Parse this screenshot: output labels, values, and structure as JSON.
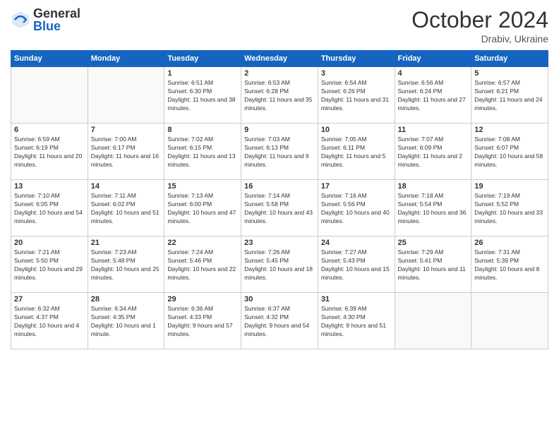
{
  "header": {
    "logo_general": "General",
    "logo_blue": "Blue",
    "month_title": "October 2024",
    "location": "Drabiv, Ukraine"
  },
  "weekdays": [
    "Sunday",
    "Monday",
    "Tuesday",
    "Wednesday",
    "Thursday",
    "Friday",
    "Saturday"
  ],
  "weeks": [
    [
      {
        "day": "",
        "sunrise": "",
        "sunset": "",
        "daylight": ""
      },
      {
        "day": "",
        "sunrise": "",
        "sunset": "",
        "daylight": ""
      },
      {
        "day": "1",
        "sunrise": "Sunrise: 6:51 AM",
        "sunset": "Sunset: 6:30 PM",
        "daylight": "Daylight: 11 hours and 38 minutes."
      },
      {
        "day": "2",
        "sunrise": "Sunrise: 6:53 AM",
        "sunset": "Sunset: 6:28 PM",
        "daylight": "Daylight: 11 hours and 35 minutes."
      },
      {
        "day": "3",
        "sunrise": "Sunrise: 6:54 AM",
        "sunset": "Sunset: 6:26 PM",
        "daylight": "Daylight: 11 hours and 31 minutes."
      },
      {
        "day": "4",
        "sunrise": "Sunrise: 6:56 AM",
        "sunset": "Sunset: 6:24 PM",
        "daylight": "Daylight: 11 hours and 27 minutes."
      },
      {
        "day": "5",
        "sunrise": "Sunrise: 6:57 AM",
        "sunset": "Sunset: 6:21 PM",
        "daylight": "Daylight: 11 hours and 24 minutes."
      }
    ],
    [
      {
        "day": "6",
        "sunrise": "Sunrise: 6:59 AM",
        "sunset": "Sunset: 6:19 PM",
        "daylight": "Daylight: 11 hours and 20 minutes."
      },
      {
        "day": "7",
        "sunrise": "Sunrise: 7:00 AM",
        "sunset": "Sunset: 6:17 PM",
        "daylight": "Daylight: 11 hours and 16 minutes."
      },
      {
        "day": "8",
        "sunrise": "Sunrise: 7:02 AM",
        "sunset": "Sunset: 6:15 PM",
        "daylight": "Daylight: 11 hours and 13 minutes."
      },
      {
        "day": "9",
        "sunrise": "Sunrise: 7:03 AM",
        "sunset": "Sunset: 6:13 PM",
        "daylight": "Daylight: 11 hours and 9 minutes."
      },
      {
        "day": "10",
        "sunrise": "Sunrise: 7:05 AM",
        "sunset": "Sunset: 6:11 PM",
        "daylight": "Daylight: 11 hours and 5 minutes."
      },
      {
        "day": "11",
        "sunrise": "Sunrise: 7:07 AM",
        "sunset": "Sunset: 6:09 PM",
        "daylight": "Daylight: 11 hours and 2 minutes."
      },
      {
        "day": "12",
        "sunrise": "Sunrise: 7:08 AM",
        "sunset": "Sunset: 6:07 PM",
        "daylight": "Daylight: 10 hours and 58 minutes."
      }
    ],
    [
      {
        "day": "13",
        "sunrise": "Sunrise: 7:10 AM",
        "sunset": "Sunset: 6:05 PM",
        "daylight": "Daylight: 10 hours and 54 minutes."
      },
      {
        "day": "14",
        "sunrise": "Sunrise: 7:11 AM",
        "sunset": "Sunset: 6:02 PM",
        "daylight": "Daylight: 10 hours and 51 minutes."
      },
      {
        "day": "15",
        "sunrise": "Sunrise: 7:13 AM",
        "sunset": "Sunset: 6:00 PM",
        "daylight": "Daylight: 10 hours and 47 minutes."
      },
      {
        "day": "16",
        "sunrise": "Sunrise: 7:14 AM",
        "sunset": "Sunset: 5:58 PM",
        "daylight": "Daylight: 10 hours and 43 minutes."
      },
      {
        "day": "17",
        "sunrise": "Sunrise: 7:16 AM",
        "sunset": "Sunset: 5:56 PM",
        "daylight": "Daylight: 10 hours and 40 minutes."
      },
      {
        "day": "18",
        "sunrise": "Sunrise: 7:18 AM",
        "sunset": "Sunset: 5:54 PM",
        "daylight": "Daylight: 10 hours and 36 minutes."
      },
      {
        "day": "19",
        "sunrise": "Sunrise: 7:19 AM",
        "sunset": "Sunset: 5:52 PM",
        "daylight": "Daylight: 10 hours and 33 minutes."
      }
    ],
    [
      {
        "day": "20",
        "sunrise": "Sunrise: 7:21 AM",
        "sunset": "Sunset: 5:50 PM",
        "daylight": "Daylight: 10 hours and 29 minutes."
      },
      {
        "day": "21",
        "sunrise": "Sunrise: 7:23 AM",
        "sunset": "Sunset: 5:48 PM",
        "daylight": "Daylight: 10 hours and 25 minutes."
      },
      {
        "day": "22",
        "sunrise": "Sunrise: 7:24 AM",
        "sunset": "Sunset: 5:46 PM",
        "daylight": "Daylight: 10 hours and 22 minutes."
      },
      {
        "day": "23",
        "sunrise": "Sunrise: 7:26 AM",
        "sunset": "Sunset: 5:45 PM",
        "daylight": "Daylight: 10 hours and 18 minutes."
      },
      {
        "day": "24",
        "sunrise": "Sunrise: 7:27 AM",
        "sunset": "Sunset: 5:43 PM",
        "daylight": "Daylight: 10 hours and 15 minutes."
      },
      {
        "day": "25",
        "sunrise": "Sunrise: 7:29 AM",
        "sunset": "Sunset: 5:41 PM",
        "daylight": "Daylight: 10 hours and 11 minutes."
      },
      {
        "day": "26",
        "sunrise": "Sunrise: 7:31 AM",
        "sunset": "Sunset: 5:39 PM",
        "daylight": "Daylight: 10 hours and 8 minutes."
      }
    ],
    [
      {
        "day": "27",
        "sunrise": "Sunrise: 6:32 AM",
        "sunset": "Sunset: 4:37 PM",
        "daylight": "Daylight: 10 hours and 4 minutes."
      },
      {
        "day": "28",
        "sunrise": "Sunrise: 6:34 AM",
        "sunset": "Sunset: 4:35 PM",
        "daylight": "Daylight: 10 hours and 1 minute."
      },
      {
        "day": "29",
        "sunrise": "Sunrise: 6:36 AM",
        "sunset": "Sunset: 4:33 PM",
        "daylight": "Daylight: 9 hours and 57 minutes."
      },
      {
        "day": "30",
        "sunrise": "Sunrise: 6:37 AM",
        "sunset": "Sunset: 4:32 PM",
        "daylight": "Daylight: 9 hours and 54 minutes."
      },
      {
        "day": "31",
        "sunrise": "Sunrise: 6:39 AM",
        "sunset": "Sunset: 4:30 PM",
        "daylight": "Daylight: 9 hours and 51 minutes."
      },
      {
        "day": "",
        "sunrise": "",
        "sunset": "",
        "daylight": ""
      },
      {
        "day": "",
        "sunrise": "",
        "sunset": "",
        "daylight": ""
      }
    ]
  ]
}
